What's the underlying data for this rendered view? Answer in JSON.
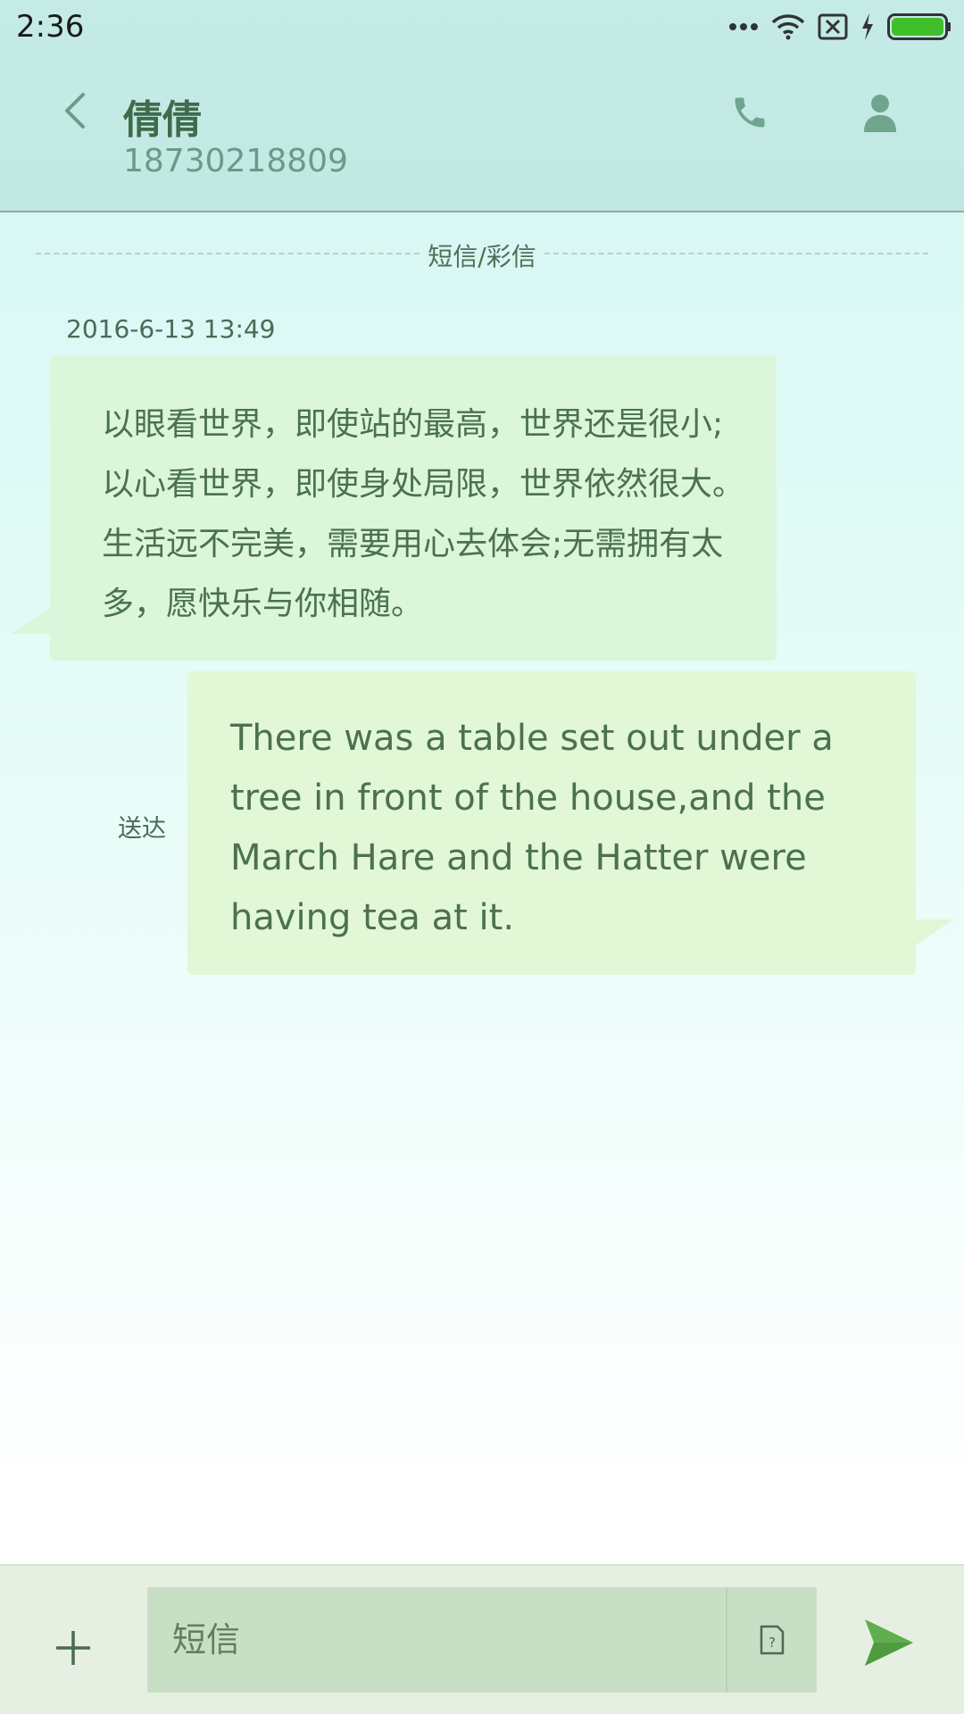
{
  "status_bar": {
    "time": "2:36",
    "icons": [
      "more-dots-icon",
      "wifi-icon",
      "no-sim-icon",
      "charging-icon",
      "battery-icon"
    ],
    "battery_color": "#3fbf2a"
  },
  "header": {
    "contact_name": "倩倩",
    "contact_number": "18730218809",
    "icons": [
      "back-arrow-icon",
      "phone-icon",
      "person-icon"
    ]
  },
  "conversation": {
    "service_label": "短信/彩信",
    "messages": [
      {
        "direction": "incoming",
        "timestamp": "2016-6-13 13:49",
        "text": "以眼看世界，即使站的最高，世界还是很小;以心看世界，即使身处局限，世界依然很大。生活远不完美，需要用心去体会;无需拥有太多，愿快乐与你相随。"
      },
      {
        "direction": "outgoing",
        "status": "送达",
        "text": "There was a table set out under a tree in front of the house,and the March Hare and the Hatter were having tea at it."
      }
    ]
  },
  "compose": {
    "placeholder": "短信",
    "value": "",
    "icons": [
      "plus-icon",
      "sim-card-icon",
      "send-icon"
    ],
    "accent_color": "#5fae4f"
  }
}
